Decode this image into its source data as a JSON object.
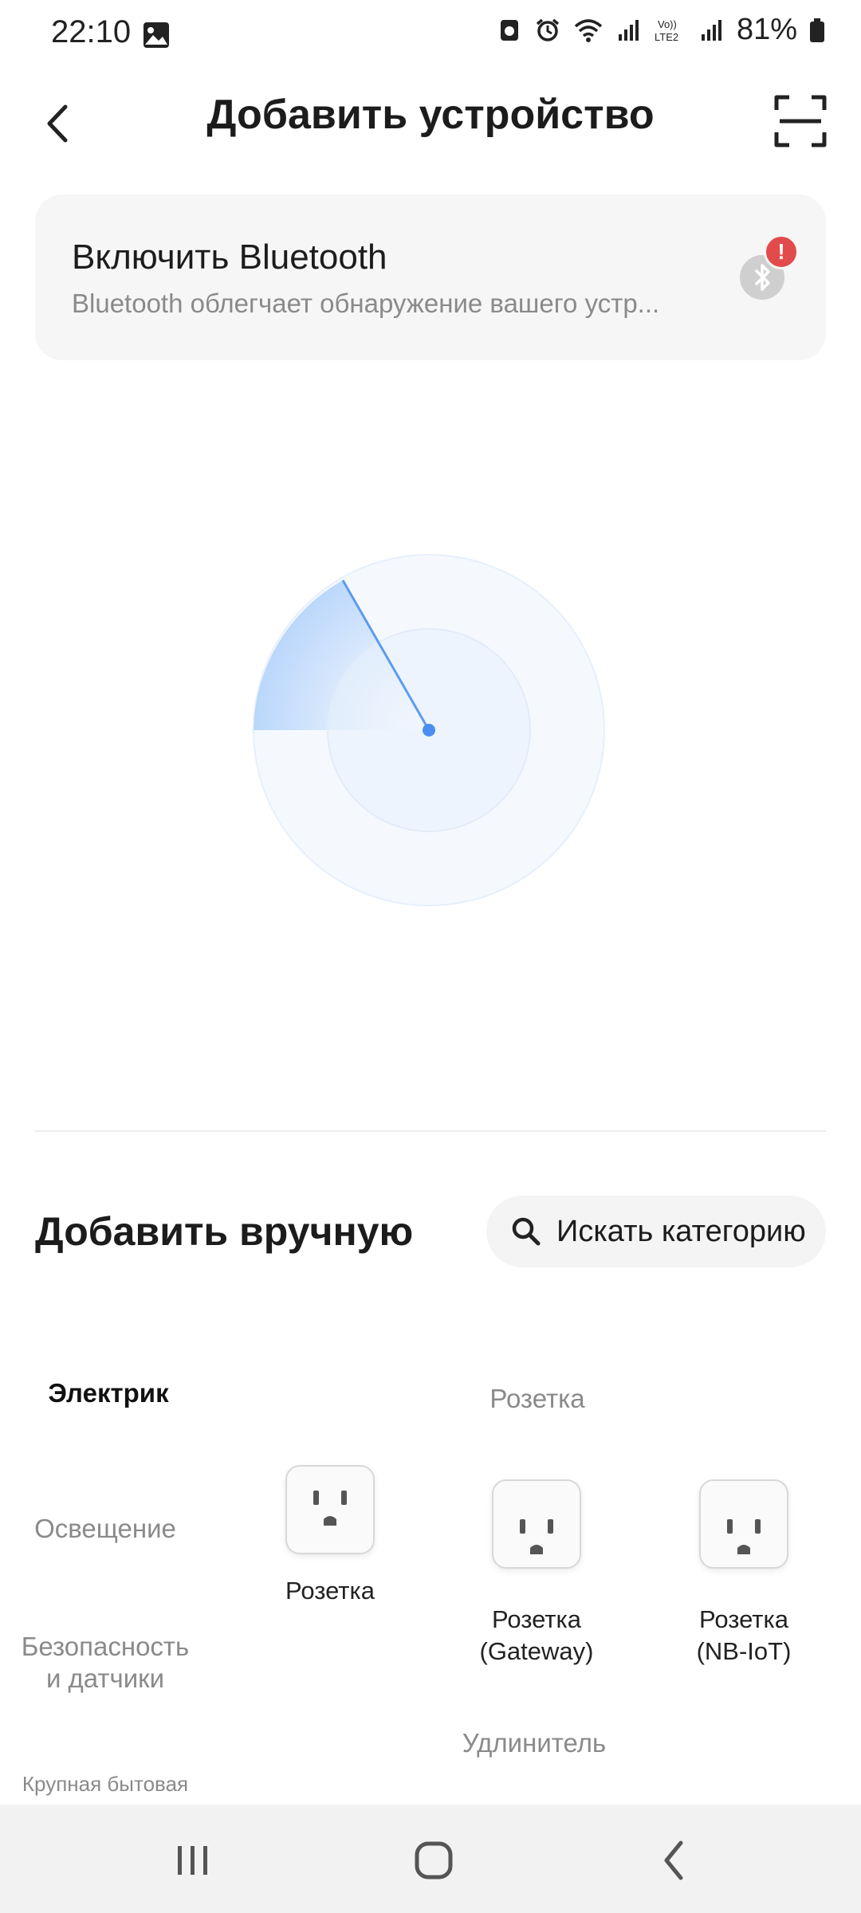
{
  "status_bar": {
    "time": "22:10",
    "battery": "81%",
    "icons": [
      "image-icon",
      "bank-icon",
      "alarm-icon",
      "wifi-icon",
      "signal-icon",
      "volte-icon",
      "signal-icon",
      "battery-icon"
    ]
  },
  "header": {
    "title": "Добавить устройство",
    "back_icon": "back-arrow-icon",
    "scan_icon": "scan-icon"
  },
  "bluetooth_card": {
    "title": "Включить Bluetooth",
    "subtitle": "Bluetooth облегчает обнаружение вашего устр...",
    "icon": "bluetooth-icon",
    "alert": "!"
  },
  "manual": {
    "title": "Добавить вручную",
    "search_label": "Искать категорию"
  },
  "categories": [
    {
      "label": "Электрик",
      "active": true
    },
    {
      "label": "Освещение",
      "active": false
    },
    {
      "label": "Безопасность\nи датчики",
      "active": false
    },
    {
      "label": "Крупная бытовая",
      "active": false
    }
  ],
  "sections": [
    {
      "title": "Розетка",
      "devices": [
        {
          "label": "Розетка",
          "icon": "socket-icon"
        },
        {
          "label": "Розетка\n(Gateway)",
          "icon": "socket-icon"
        },
        {
          "label": "Розетка\n(NB-IoT)",
          "icon": "socket-icon"
        }
      ]
    },
    {
      "title": "Удлинитель",
      "devices": []
    }
  ],
  "nav_bar": [
    "recents-icon",
    "home-icon",
    "back-icon"
  ],
  "colors": {
    "accent": "#3d8bf2",
    "alert": "#e24b4b"
  }
}
